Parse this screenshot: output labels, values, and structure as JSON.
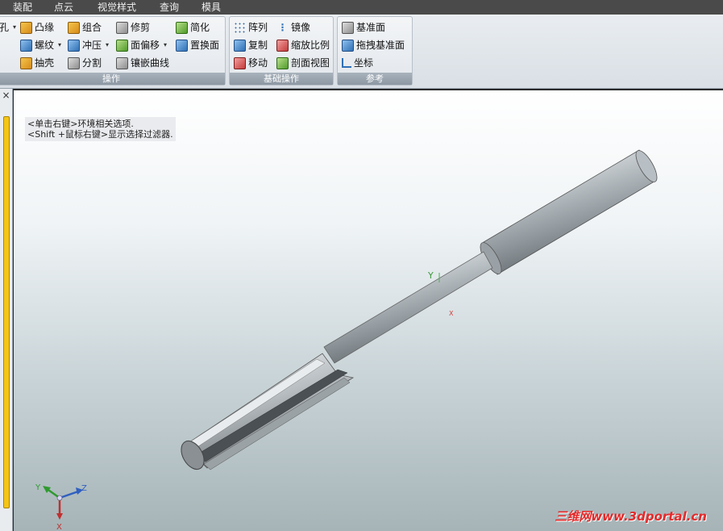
{
  "menu": [
    "装配",
    "点云",
    "视觉样式",
    "查询",
    "模具"
  ],
  "ribbon": {
    "ops": {
      "label": "操作",
      "hole": "孔",
      "boss": "凸缘",
      "combine": "组合",
      "trim": "修剪",
      "simplify": "简化",
      "thread": "螺纹",
      "stamp": "冲压",
      "face_offset": "面偏移",
      "replace_face": "置换面",
      "shell": "抽壳",
      "split": "分割",
      "emboss_curve": "镶嵌曲线"
    },
    "basic": {
      "label": "基础操作",
      "array": "阵列",
      "mirror": "镜像",
      "copy": "复制",
      "scale": "缩放比例",
      "move": "移动",
      "section_view": "剖面视图"
    },
    "ref": {
      "label": "参考",
      "datum_plane": "基准面",
      "drag_datum": "拖拽基准面",
      "coord": "坐标"
    }
  },
  "viewport": {
    "hint_line1": "<单击右键>环境相关选项.",
    "hint_line2": "<Shift +鼠标右键>显示选择过滤器.",
    "axis_y": "Y",
    "axis_z": "Z",
    "axis_x": "X",
    "triad_y": "Y",
    "triad_z": "Z",
    "triad_x": "X",
    "watermark": "三维网www.3dportal.cn"
  },
  "leftdock": {
    "close": "×"
  }
}
